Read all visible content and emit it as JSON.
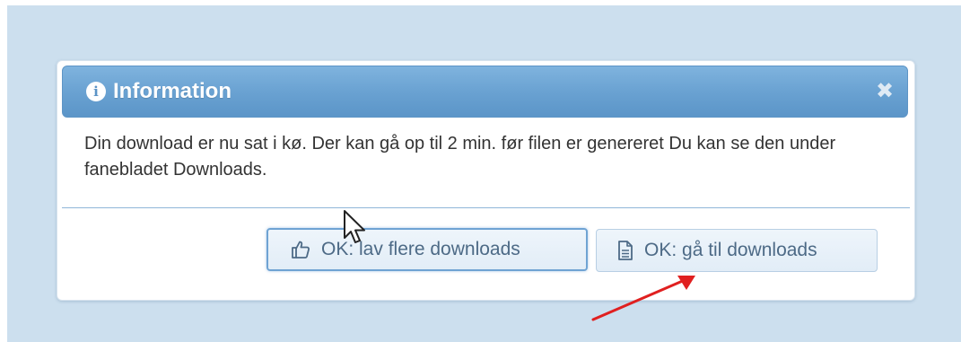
{
  "dialog": {
    "title": "Information",
    "title_icon": "info-icon",
    "close_icon": "close-icon",
    "message": "Din download er nu sat i kø. Der kan gå op til 2 min. før filen er genereret Du kan se den under fanebladet Downloads."
  },
  "buttons": {
    "more_downloads": {
      "label": "OK: lav flere downloads",
      "icon": "thumbs-up-icon"
    },
    "goto_downloads": {
      "label": "OK: gå til downloads",
      "icon": "document-icon"
    }
  },
  "annotations": {
    "pointer": "mouse-cursor-icon",
    "arrow": "red-arrow",
    "arrow_color": "#e02020"
  },
  "colors": {
    "backdrop": "#ccdfee",
    "titlebar": "#6aa2d2",
    "divider": "#8fb6d8",
    "button_text": "#4d6a86"
  }
}
